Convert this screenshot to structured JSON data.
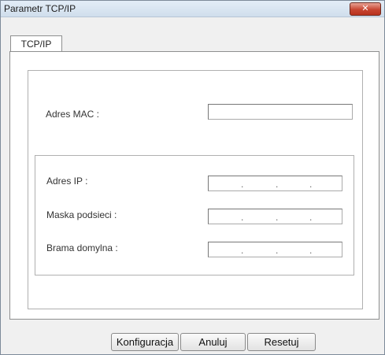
{
  "window": {
    "title": "Parametr TCP/IP",
    "close_glyph": "✕"
  },
  "tabs": [
    {
      "label": "TCP/IP"
    }
  ],
  "form": {
    "mac_label": "Adres MAC :",
    "mac_value": "",
    "ip_label": "Adres IP :",
    "subnet_label": "Maska podsieci :",
    "gateway_label": "Brama domylna :",
    "ip_separator": "."
  },
  "buttons": {
    "configure": "Konfiguracja",
    "cancel": "Anuluj",
    "reset": "Resetuj"
  },
  "colors": {
    "close_button": "#c74531",
    "title_bar": "#dbe6f2"
  }
}
